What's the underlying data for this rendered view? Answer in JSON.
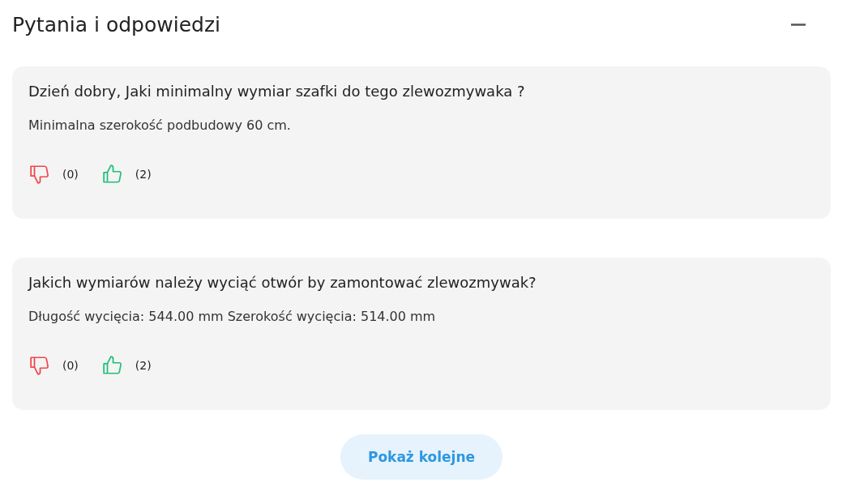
{
  "section": {
    "title": "Pytania i odpowiedzi",
    "expanded": true
  },
  "questions": [
    {
      "question": "Dzień dobry, Jaki minimalny wymiar szafki do tego zlewozmywaka ?",
      "answer": "Minimalna szerokość podbudowy 60 cm.",
      "dislikes": "(0)",
      "likes": "(2)"
    },
    {
      "question": "Jakich wymiarów należy wyciąć otwór by zamontować zlewozmywak?",
      "answer": "Długość wycięcia: 544.00 mm Szerokość wycięcia: 514.00 mm",
      "dislikes": "(0)",
      "likes": "(2)"
    }
  ],
  "more_button": "Pokaż kolejne"
}
